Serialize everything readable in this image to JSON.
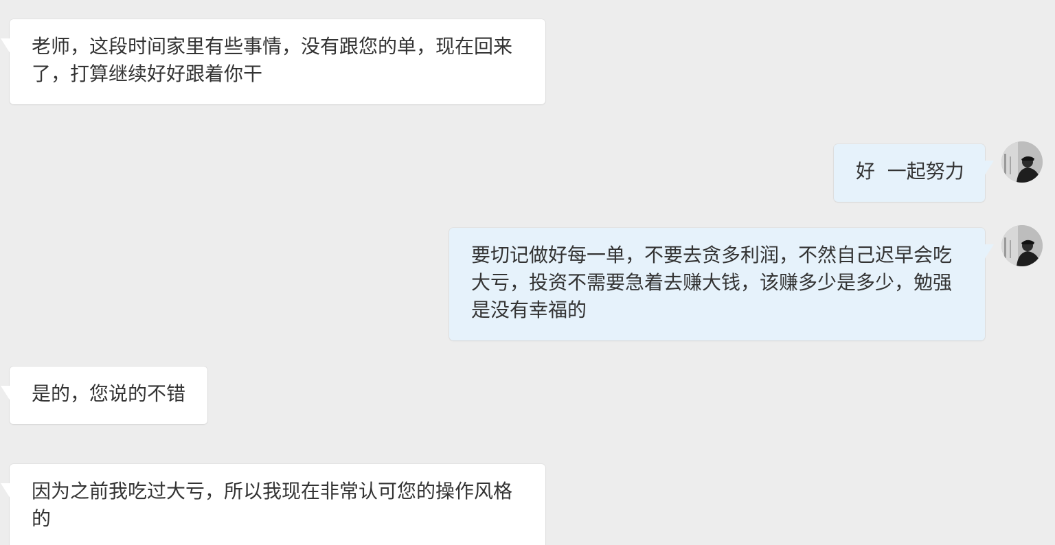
{
  "messages": [
    {
      "side": "left",
      "text": "老师，这段时间家里有些事情，没有跟您的单，现在回来了，打算继续好好跟着你干"
    },
    {
      "side": "right",
      "text": "好  一起努力"
    },
    {
      "side": "right",
      "text": "要切记做好每一单，不要去贪多利润，不然自己迟早会吃大亏，投资不需要急着去赚大钱，该赚多少是多少，勉强是没有幸福的"
    },
    {
      "side": "left",
      "text": "是的，您说的不错"
    },
    {
      "side": "left",
      "text": "因为之前我吃过大亏，所以我现在非常认可您的操作风格的"
    }
  ],
  "avatar_icon": "user-avatar-photo",
  "colors": {
    "background": "#ededed",
    "incoming_bubble": "#ffffff",
    "outgoing_bubble": "#e6f2fb",
    "text": "#333333"
  }
}
